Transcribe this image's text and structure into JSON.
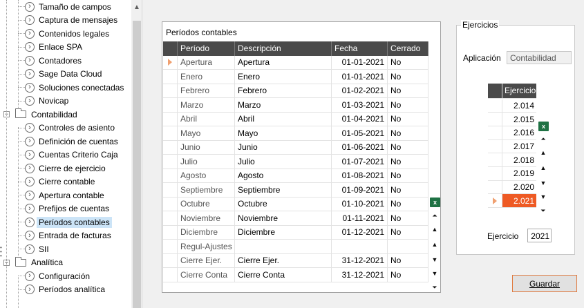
{
  "tree": {
    "items": [
      {
        "label": "Tamaño de campos",
        "type": "leaf",
        "level": 2
      },
      {
        "label": "Captura de mensajes",
        "type": "leaf",
        "level": 2
      },
      {
        "label": "Contenidos legales",
        "type": "leaf",
        "level": 2
      },
      {
        "label": "Enlace SPA",
        "type": "leaf",
        "level": 2
      },
      {
        "label": "Contadores",
        "type": "leaf",
        "level": 2
      },
      {
        "label": "Sage Data Cloud",
        "type": "leaf",
        "level": 2
      },
      {
        "label": "Soluciones conectadas",
        "type": "leaf",
        "level": 2
      },
      {
        "label": "Novicap",
        "type": "leaf",
        "level": 2
      },
      {
        "label": "Contabilidad",
        "type": "folder",
        "level": 1
      },
      {
        "label": "Controles de asiento",
        "type": "leaf",
        "level": 2
      },
      {
        "label": "Definición de cuentas",
        "type": "leaf",
        "level": 2
      },
      {
        "label": "Cuentas Criterio Caja",
        "type": "leaf",
        "level": 2
      },
      {
        "label": "Cierre de ejercicio",
        "type": "leaf",
        "level": 2
      },
      {
        "label": "Cierre contable",
        "type": "leaf",
        "level": 2
      },
      {
        "label": "Apertura contable",
        "type": "leaf",
        "level": 2
      },
      {
        "label": "Prefijos de cuentas",
        "type": "leaf",
        "level": 2
      },
      {
        "label": "Períodos contables",
        "type": "leaf",
        "level": 2,
        "selected": true
      },
      {
        "label": "Entrada de facturas",
        "type": "leaf",
        "level": 2
      },
      {
        "label": "SII",
        "type": "leaf",
        "level": 2
      },
      {
        "label": "Analítica",
        "type": "folder",
        "level": 1
      },
      {
        "label": "Configuración",
        "type": "leaf",
        "level": 2
      },
      {
        "label": "Períodos analítica",
        "type": "leaf",
        "level": 2
      }
    ]
  },
  "periods": {
    "title": "Períodos contables",
    "columns": [
      "Período",
      "Descripción",
      "Fecha",
      "Cerrado"
    ],
    "rows": [
      [
        "Apertura",
        "Apertura",
        "01-01-2021",
        "No"
      ],
      [
        "Enero",
        "Enero",
        "01-01-2021",
        "No"
      ],
      [
        "Febrero",
        "Febrero",
        "01-02-2021",
        "No"
      ],
      [
        "Marzo",
        "Marzo",
        "01-03-2021",
        "No"
      ],
      [
        "Abril",
        "Abril",
        "01-04-2021",
        "No"
      ],
      [
        "Mayo",
        "Mayo",
        "01-05-2021",
        "No"
      ],
      [
        "Junio",
        "Junio",
        "01-06-2021",
        "No"
      ],
      [
        "Julio",
        "Julio",
        "01-07-2021",
        "No"
      ],
      [
        "Agosto",
        "Agosto",
        "01-08-2021",
        "No"
      ],
      [
        "Septiembre",
        "Septiembre",
        "01-09-2021",
        "No"
      ],
      [
        "Octubre",
        "Octubre",
        "01-10-2021",
        "No"
      ],
      [
        "Noviembre",
        "Noviembre",
        "01-11-2021",
        "No"
      ],
      [
        "Diciembre",
        "Diciembre",
        "01-12-2021",
        "No"
      ],
      [
        "Regul-Ajustes",
        "",
        "",
        ""
      ],
      [
        "Cierre Ejer.",
        "Cierre Ejer.",
        "31-12-2021",
        "No"
      ],
      [
        "Cierre Conta",
        "Cierre Conta",
        "31-12-2021",
        "No"
      ]
    ],
    "current_row": 0
  },
  "ejercicios": {
    "legend": "Ejercicios",
    "aplicacion_label": "Aplicación",
    "aplicacion_value": "Contabilidad",
    "column": "Ejercicio",
    "years": [
      "2.014",
      "2.015",
      "2.016",
      "2.017",
      "2.018",
      "2.019",
      "2.020",
      "2.021"
    ],
    "selected_index": 7,
    "ejercicio_label": "Ejercicio",
    "ejercicio_value": "2021"
  },
  "actions": {
    "save_label": "Guardar"
  },
  "colors": {
    "grid_header": "#4a4a4a",
    "selected_year": "#ee5a24",
    "excel_icon": "#1f7244"
  },
  "icons": [
    "chevron-circle-icon",
    "folder-icon",
    "collapse-icon",
    "excel-export-icon",
    "first-record-icon",
    "prev-page-icon",
    "prev-record-icon",
    "next-record-icon",
    "next-page-icon",
    "last-record-icon"
  ]
}
